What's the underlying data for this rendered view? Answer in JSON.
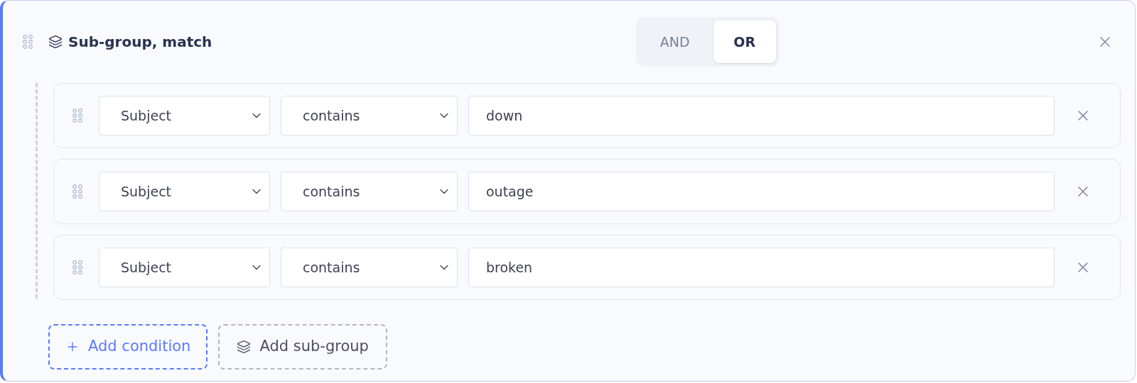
{
  "group": {
    "title": "Sub-group, match",
    "operators": [
      {
        "label": "AND",
        "selected": false
      },
      {
        "label": "OR",
        "selected": true
      }
    ],
    "conditions": [
      {
        "field": "Subject",
        "operator": "contains",
        "value": "down"
      },
      {
        "field": "Subject",
        "operator": "contains",
        "value": "outage"
      },
      {
        "field": "Subject",
        "operator": "contains",
        "value": "broken"
      }
    ],
    "actions": [
      {
        "kind": "condition",
        "label": "Add condition"
      },
      {
        "kind": "subgroup",
        "label": "Add sub-group"
      }
    ]
  }
}
